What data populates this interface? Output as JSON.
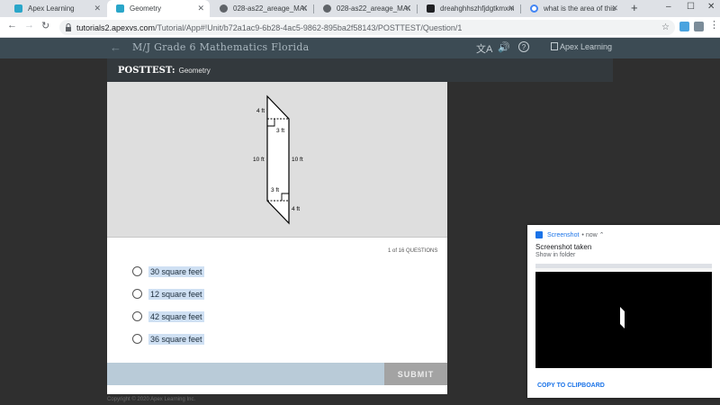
{
  "browser": {
    "tabs": [
      {
        "title": "Apex Learning",
        "icon": "apex-favicon",
        "active": false
      },
      {
        "title": "Geometry",
        "icon": "apex-favicon",
        "active": true
      },
      {
        "title": "028-as22_areage_MAG6",
        "icon": "globe-favicon",
        "active": false
      },
      {
        "title": "028-as22_areage_MAG6",
        "icon": "globe-favicon",
        "active": false
      },
      {
        "title": "dreahghhszhfjdgtkmxm",
        "icon": "dark-favicon",
        "active": false
      },
      {
        "title": "what is the area of this",
        "icon": "google-favicon",
        "active": false
      }
    ],
    "new_tab": "+",
    "window_controls": {
      "minimize": "–",
      "maximize": "☐",
      "close": "✕"
    },
    "url_host": "tutorials2.apexvs.com",
    "url_path": "/Tutorial/App#!Unit/b72a1ac9-6b28-4ac5-9862-895ba2f58143/POSTTEST/Question/1"
  },
  "app": {
    "course_title": "M/J Grade 6 Mathematics Florida",
    "brand": "Apex Learning",
    "icons": [
      "translate-icon",
      "audio-icon",
      "help-icon"
    ],
    "posttest_label": "POSTTEST:",
    "posttest_topic": "Geometry"
  },
  "figure": {
    "labels": {
      "top_left": "4 ft",
      "top_height": "3 ft",
      "left_side": "10 ft",
      "right_side": "10 ft",
      "bottom_height": "3 ft",
      "bottom_right": "4 ft"
    }
  },
  "question": {
    "counter": "1 of 16 QUESTIONS",
    "answers": [
      "30 square feet",
      "12 square feet",
      "42 square feet",
      "36 square feet"
    ],
    "submit_label": "SUBMIT"
  },
  "footer": {
    "copyright": "Copyright © 2020 Apex Learning Inc."
  },
  "notification": {
    "app": "Screenshot",
    "when": "• now ⌃",
    "title": "Screenshot taken",
    "message": "Show in folder",
    "action": "COPY TO CLIPBOARD"
  }
}
